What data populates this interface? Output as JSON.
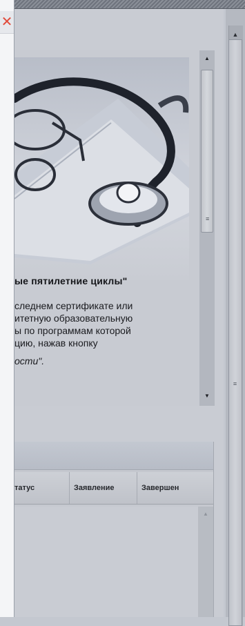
{
  "left_panel": {
    "close_icon": "close-icon"
  },
  "news": {
    "title": "ые пятилетние циклы\"",
    "body_lines": [
      "следнем сертификате или",
      "итетную  образовательную",
      "ы по программам которой",
      "цию,       нажав      кнопку"
    ],
    "body_italic": "ости\"."
  },
  "table": {
    "columns": [
      "татус",
      "Заявление",
      "Завершен"
    ]
  },
  "scroll": {
    "up_glyph": "▲",
    "down_glyph": "▼",
    "grip_glyph": "≡"
  }
}
